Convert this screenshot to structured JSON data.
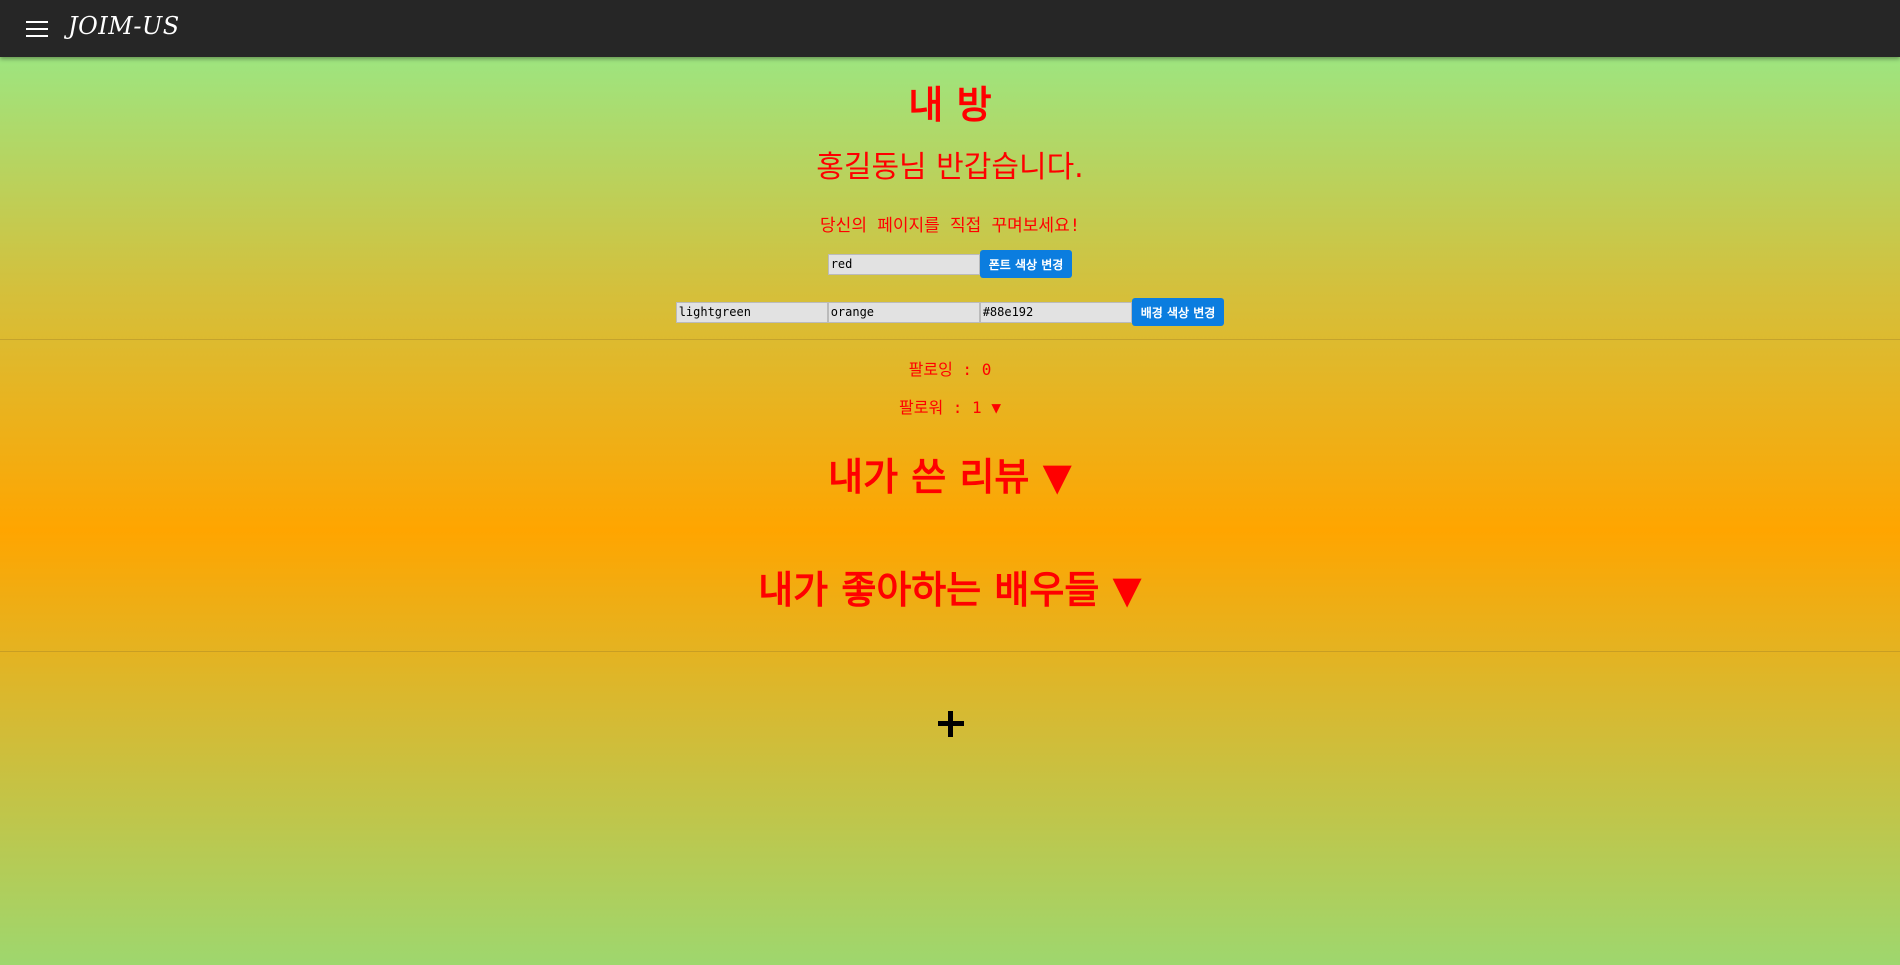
{
  "navbar": {
    "menu_icon": "hamburger-menu-icon",
    "brand": "JOIM-US"
  },
  "page": {
    "title": "내 방",
    "greeting": "홍길동님 반갑습니다.",
    "subtitle": "당신의 페이지를 직접 꾸며보세요!"
  },
  "font_color": {
    "value": "red",
    "button_label": "폰트 색상 변경"
  },
  "background_color": {
    "value1": "lightgreen",
    "value2": "orange",
    "value3": "#88e192",
    "button_label": "배경 색상 변경"
  },
  "follow": {
    "following_label": "팔로잉 : 0",
    "followers_label": "팔로워 : 1",
    "followers_toggle": "▼"
  },
  "sections": {
    "reviews_label": "내가 쓴 리뷰",
    "reviews_toggle": "▼",
    "actors_label": "내가 좋아하는 배우들",
    "actors_toggle": "▼"
  },
  "add": {
    "icon": "plus-icon"
  },
  "colors": {
    "text": "#ff0000",
    "navbar": "#262626",
    "button": "#0b7ddf",
    "gradient": [
      "#90ee90",
      "#ffa500",
      "#88e192"
    ]
  }
}
